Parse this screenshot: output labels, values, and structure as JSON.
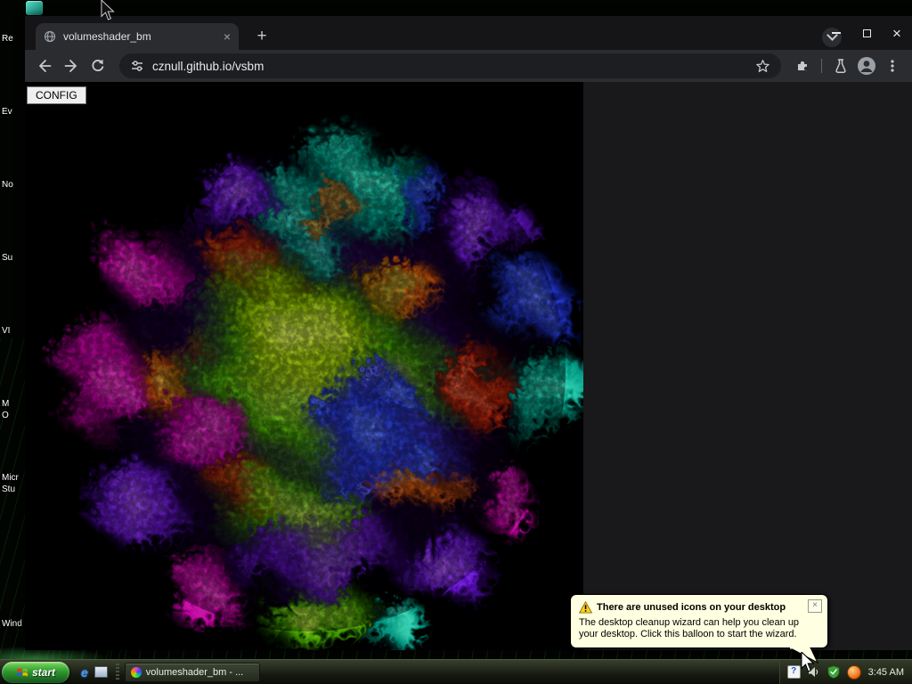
{
  "desktop": {
    "icon_labels": [
      "Re",
      "Ev",
      "No",
      "Su",
      "VI",
      "M",
      "O",
      "Micr",
      "Stu",
      "Wind"
    ]
  },
  "browser": {
    "tab_title": "volumeshader_bm",
    "url": "cznull.github.io/vsbm",
    "config_label": "CONFIG"
  },
  "balloon": {
    "title": "There are unused icons on your desktop",
    "body": "The desktop cleanup wizard can help you clean up your desktop. Click this balloon to start the wizard."
  },
  "taskbar": {
    "start_label": "start",
    "task_button_label": "volumeshader_bm - ...",
    "clock": "3:45 AM"
  },
  "icons": {
    "close": "×",
    "new_tab": "+",
    "ie": "e",
    "help": "?"
  }
}
